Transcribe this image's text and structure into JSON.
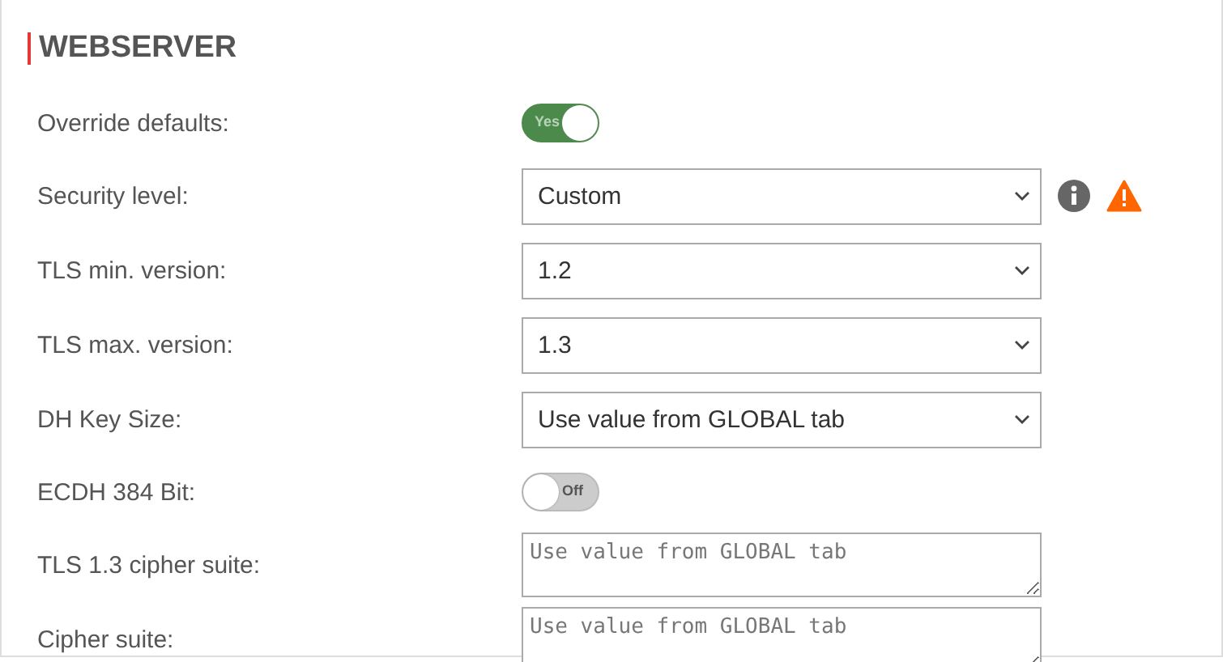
{
  "section": {
    "title": "WEBSERVER"
  },
  "rows": [
    {
      "kind": "toggle",
      "label": "Override defaults:",
      "on": true,
      "text": "Yes"
    },
    {
      "kind": "select",
      "label": "Security level:",
      "value": "Custom",
      "badges": [
        {
          "kind": "info"
        },
        {
          "kind": "warning"
        }
      ]
    },
    {
      "kind": "select",
      "label": "TLS min. version:",
      "value": "1.2"
    },
    {
      "kind": "select",
      "label": "TLS max. version:",
      "value": "1.3"
    },
    {
      "kind": "select",
      "label": "DH Key Size:",
      "value": "Use value from GLOBAL tab"
    },
    {
      "kind": "toggle",
      "label": "ECDH 384 Bit:",
      "on": false,
      "text": "Off"
    },
    {
      "kind": "textarea",
      "label": "TLS 1.3 cipher suite:",
      "placeholder": "Use value from GLOBAL tab"
    },
    {
      "kind": "textarea",
      "label": "Cipher suite:",
      "placeholder": "Use value from GLOBAL tab"
    }
  ]
}
